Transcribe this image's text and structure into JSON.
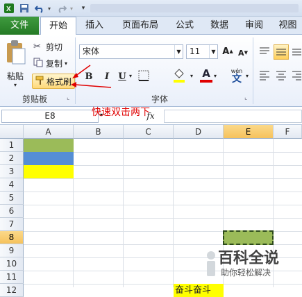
{
  "quick_access": {
    "save_icon": "save-icon",
    "undo_icon": "undo-icon",
    "redo_icon": "redo-icon",
    "customize_icon": "customize-icon"
  },
  "tabs": [
    {
      "label": "文件"
    },
    {
      "label": "开始"
    },
    {
      "label": "插入"
    },
    {
      "label": "页面布局"
    },
    {
      "label": "公式"
    },
    {
      "label": "数据"
    },
    {
      "label": "审阅"
    },
    {
      "label": "视图"
    }
  ],
  "clipboard": {
    "paste_label": "粘贴",
    "cut_label": "剪切",
    "copy_label": "复制",
    "format_painter_label": "格式刷",
    "group_label": "剪贴板"
  },
  "font": {
    "font_name": "宋体",
    "font_size": "11",
    "bold": "B",
    "italic": "I",
    "underline": "U",
    "phonetic": "wén",
    "group_label": "字体"
  },
  "annotation": {
    "text": "快速双击两下"
  },
  "formula_bar": {
    "name_box": "E8",
    "fx": "fx"
  },
  "columns": [
    "A",
    "B",
    "C",
    "D",
    "E",
    "F"
  ],
  "rows": [
    "1",
    "2",
    "3",
    "4",
    "5",
    "6",
    "7",
    "8",
    "9",
    "10",
    "11",
    "12"
  ],
  "selected": {
    "column": "E",
    "row": "8"
  },
  "cells": {
    "d12_text": "奋斗奋斗"
  },
  "colors": {
    "a1": "#9bbb59",
    "a2": "#558ed5",
    "a3": "#ffff00",
    "e8": "#9bbb59",
    "d12": "#ffff00",
    "annotation": "#e00000",
    "file_tab": "#2f8b2f"
  },
  "watermark": {
    "title": "百科全说",
    "subtitle": "助你轻松解决"
  }
}
